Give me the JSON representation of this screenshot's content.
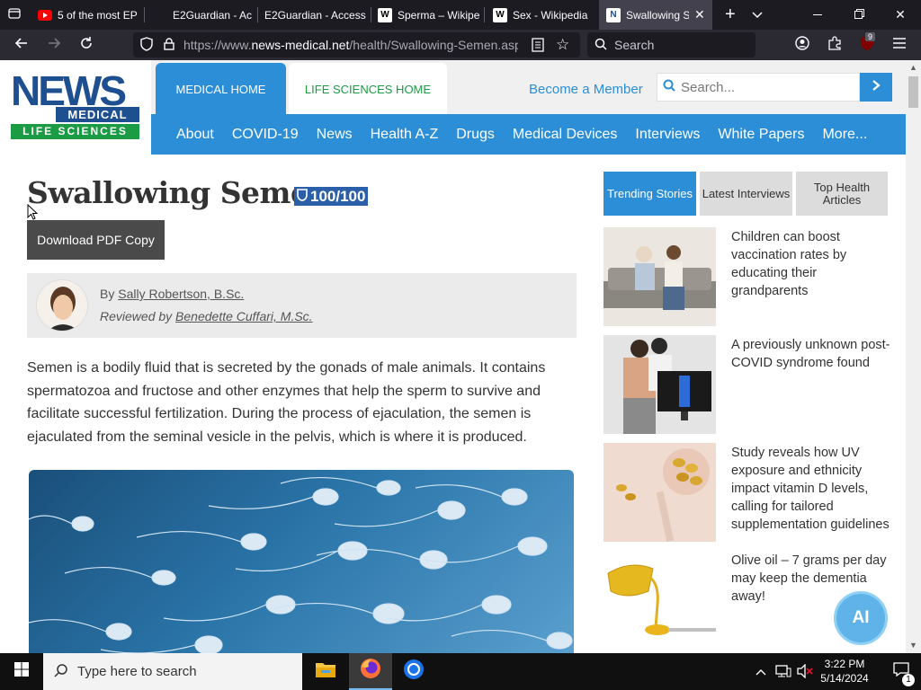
{
  "browser": {
    "tabs": [
      {
        "title": "5 of the most EP",
        "icon": "youtube-icon"
      },
      {
        "title": "E2Guardian - Ac",
        "icon": "blank-page-icon"
      },
      {
        "title": "E2Guardian - Access",
        "icon": "blank-page-icon"
      },
      {
        "title": "Sperma – Wikipe",
        "icon": "wikipedia-icon"
      },
      {
        "title": "Sex - Wikipedia",
        "icon": "wikipedia-icon"
      },
      {
        "title": "Swallowing Se",
        "icon": "news-medical-icon"
      }
    ],
    "url_prefix": "https://www.",
    "url_domain": "news-medical.net",
    "url_path": "/health/Swallowing-Semen.asp",
    "search_placeholder": "Search",
    "extension_badge": "9"
  },
  "site": {
    "logo_news": "NEWS",
    "logo_medical": "MEDICAL",
    "logo_life": "LIFE SCIENCES",
    "top_tabs": [
      "MEDICAL HOME",
      "LIFE SCIENCES HOME"
    ],
    "member_link": "Become a Member",
    "search_placeholder": "Search...",
    "nav": [
      "About",
      "COVID-19",
      "News",
      "Health A-Z",
      "Drugs",
      "Medical Devices",
      "Interviews",
      "White Papers",
      "More..."
    ]
  },
  "article": {
    "title": "Swallowing Semen",
    "score": "100/100",
    "pdf_button": "Download PDF Copy",
    "by_prefix": "By",
    "author": "Sally Robertson, B.Sc.",
    "reviewed_prefix": "Reviewed by",
    "reviewer": "Benedette Cuffari, M.Sc.",
    "intro": "Semen is a bodily fluid that is secreted by the gonads of male animals. It contains spermatozoa and fructose and other enzymes that help the sperm to survive and facilitate successful fertilization. During the process of ejaculation, the semen is ejaculated from the seminal vesicle in the pelvis, which is where it is produced."
  },
  "sidebar": {
    "tabs": [
      "Trending Stories",
      "Latest Interviews",
      "Top Health Articles"
    ],
    "articles": [
      "Children can boost vaccination rates by educating their grandparents",
      "A previously unknown post-COVID syndrome found",
      "Study reveals how UV exposure and ethnicity impact vitamin D levels, calling for tailored supplementation guidelines",
      "Olive oil – 7 grams per day may keep the dementia away!"
    ],
    "ai_button": "AI"
  },
  "taskbar": {
    "search_placeholder": "Type here to search",
    "time": "3:22 PM",
    "date": "5/14/2024",
    "notification_count": "1"
  },
  "colors": {
    "brand_blue": "#2b8ed6",
    "logo_green": "#1a9b44",
    "logo_navy": "#1d4f91"
  }
}
